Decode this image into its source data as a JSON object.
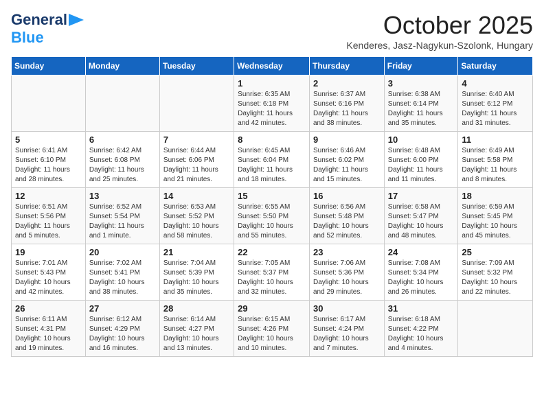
{
  "header": {
    "logo_line1": "General",
    "logo_line2": "Blue",
    "month": "October 2025",
    "location": "Kenderes, Jasz-Nagykun-Szolonk, Hungary"
  },
  "days_of_week": [
    "Sunday",
    "Monday",
    "Tuesday",
    "Wednesday",
    "Thursday",
    "Friday",
    "Saturday"
  ],
  "weeks": [
    [
      {
        "day": "",
        "info": ""
      },
      {
        "day": "",
        "info": ""
      },
      {
        "day": "",
        "info": ""
      },
      {
        "day": "1",
        "info": "Sunrise: 6:35 AM\nSunset: 6:18 PM\nDaylight: 11 hours\nand 42 minutes."
      },
      {
        "day": "2",
        "info": "Sunrise: 6:37 AM\nSunset: 6:16 PM\nDaylight: 11 hours\nand 38 minutes."
      },
      {
        "day": "3",
        "info": "Sunrise: 6:38 AM\nSunset: 6:14 PM\nDaylight: 11 hours\nand 35 minutes."
      },
      {
        "day": "4",
        "info": "Sunrise: 6:40 AM\nSunset: 6:12 PM\nDaylight: 11 hours\nand 31 minutes."
      }
    ],
    [
      {
        "day": "5",
        "info": "Sunrise: 6:41 AM\nSunset: 6:10 PM\nDaylight: 11 hours\nand 28 minutes."
      },
      {
        "day": "6",
        "info": "Sunrise: 6:42 AM\nSunset: 6:08 PM\nDaylight: 11 hours\nand 25 minutes."
      },
      {
        "day": "7",
        "info": "Sunrise: 6:44 AM\nSunset: 6:06 PM\nDaylight: 11 hours\nand 21 minutes."
      },
      {
        "day": "8",
        "info": "Sunrise: 6:45 AM\nSunset: 6:04 PM\nDaylight: 11 hours\nand 18 minutes."
      },
      {
        "day": "9",
        "info": "Sunrise: 6:46 AM\nSunset: 6:02 PM\nDaylight: 11 hours\nand 15 minutes."
      },
      {
        "day": "10",
        "info": "Sunrise: 6:48 AM\nSunset: 6:00 PM\nDaylight: 11 hours\nand 11 minutes."
      },
      {
        "day": "11",
        "info": "Sunrise: 6:49 AM\nSunset: 5:58 PM\nDaylight: 11 hours\nand 8 minutes."
      }
    ],
    [
      {
        "day": "12",
        "info": "Sunrise: 6:51 AM\nSunset: 5:56 PM\nDaylight: 11 hours\nand 5 minutes."
      },
      {
        "day": "13",
        "info": "Sunrise: 6:52 AM\nSunset: 5:54 PM\nDaylight: 11 hours\nand 1 minute."
      },
      {
        "day": "14",
        "info": "Sunrise: 6:53 AM\nSunset: 5:52 PM\nDaylight: 10 hours\nand 58 minutes."
      },
      {
        "day": "15",
        "info": "Sunrise: 6:55 AM\nSunset: 5:50 PM\nDaylight: 10 hours\nand 55 minutes."
      },
      {
        "day": "16",
        "info": "Sunrise: 6:56 AM\nSunset: 5:48 PM\nDaylight: 10 hours\nand 52 minutes."
      },
      {
        "day": "17",
        "info": "Sunrise: 6:58 AM\nSunset: 5:47 PM\nDaylight: 10 hours\nand 48 minutes."
      },
      {
        "day": "18",
        "info": "Sunrise: 6:59 AM\nSunset: 5:45 PM\nDaylight: 10 hours\nand 45 minutes."
      }
    ],
    [
      {
        "day": "19",
        "info": "Sunrise: 7:01 AM\nSunset: 5:43 PM\nDaylight: 10 hours\nand 42 minutes."
      },
      {
        "day": "20",
        "info": "Sunrise: 7:02 AM\nSunset: 5:41 PM\nDaylight: 10 hours\nand 38 minutes."
      },
      {
        "day": "21",
        "info": "Sunrise: 7:04 AM\nSunset: 5:39 PM\nDaylight: 10 hours\nand 35 minutes."
      },
      {
        "day": "22",
        "info": "Sunrise: 7:05 AM\nSunset: 5:37 PM\nDaylight: 10 hours\nand 32 minutes."
      },
      {
        "day": "23",
        "info": "Sunrise: 7:06 AM\nSunset: 5:36 PM\nDaylight: 10 hours\nand 29 minutes."
      },
      {
        "day": "24",
        "info": "Sunrise: 7:08 AM\nSunset: 5:34 PM\nDaylight: 10 hours\nand 26 minutes."
      },
      {
        "day": "25",
        "info": "Sunrise: 7:09 AM\nSunset: 5:32 PM\nDaylight: 10 hours\nand 22 minutes."
      }
    ],
    [
      {
        "day": "26",
        "info": "Sunrise: 6:11 AM\nSunset: 4:31 PM\nDaylight: 10 hours\nand 19 minutes."
      },
      {
        "day": "27",
        "info": "Sunrise: 6:12 AM\nSunset: 4:29 PM\nDaylight: 10 hours\nand 16 minutes."
      },
      {
        "day": "28",
        "info": "Sunrise: 6:14 AM\nSunset: 4:27 PM\nDaylight: 10 hours\nand 13 minutes."
      },
      {
        "day": "29",
        "info": "Sunrise: 6:15 AM\nSunset: 4:26 PM\nDaylight: 10 hours\nand 10 minutes."
      },
      {
        "day": "30",
        "info": "Sunrise: 6:17 AM\nSunset: 4:24 PM\nDaylight: 10 hours\nand 7 minutes."
      },
      {
        "day": "31",
        "info": "Sunrise: 6:18 AM\nSunset: 4:22 PM\nDaylight: 10 hours\nand 4 minutes."
      },
      {
        "day": "",
        "info": ""
      }
    ]
  ]
}
